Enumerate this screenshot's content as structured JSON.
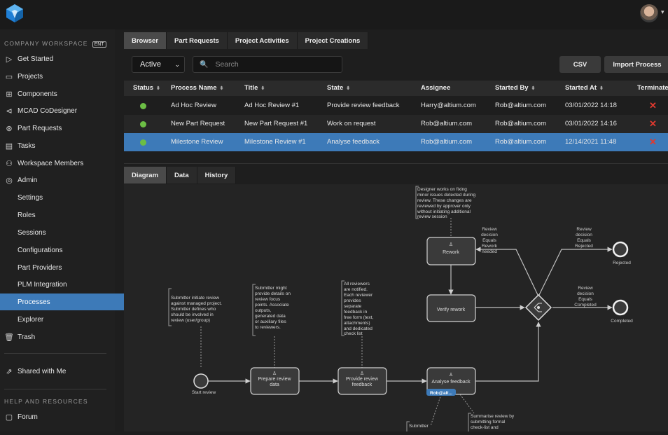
{
  "header": {
    "avatar_caret": "▾"
  },
  "sidebar": {
    "workspace_heading": "COMPANY WORKSPACE",
    "workspace_badge": "ENT",
    "items": [
      {
        "label": "Get Started",
        "icon": "play-icon"
      },
      {
        "label": "Projects",
        "icon": "folder-icon"
      },
      {
        "label": "Components",
        "icon": "chip-icon"
      },
      {
        "label": "MCAD CoDesigner",
        "icon": "codesigner-icon"
      },
      {
        "label": "Part Requests",
        "icon": "part-request-icon"
      },
      {
        "label": "Tasks",
        "icon": "tasks-icon"
      },
      {
        "label": "Workspace Members",
        "icon": "members-icon"
      },
      {
        "label": "Admin",
        "icon": "admin-icon"
      }
    ],
    "admin_items": [
      "Settings",
      "Roles",
      "Sessions",
      "Configurations",
      "Part Providers",
      "PLM Integration",
      "Processes",
      "Explorer"
    ],
    "active_item": "Processes",
    "trash_label": "Trash",
    "shared_label": "Shared with Me",
    "help_heading": "HELP AND RESOURCES",
    "forum_label": "Forum"
  },
  "tabs": [
    "Browser",
    "Part Requests",
    "Project Activities",
    "Project Creations"
  ],
  "active_tab": "Browser",
  "filter": {
    "selected": "Active",
    "search_placeholder": "Search"
  },
  "buttons": {
    "csv": "CSV",
    "import": "Import Process"
  },
  "table": {
    "columns": [
      "Status",
      "Process Name",
      "Title",
      "State",
      "Assignee",
      "Started By",
      "Started At",
      "Terminate"
    ],
    "rows": [
      {
        "name": "Ad Hoc Review",
        "title": "Ad Hoc Review #1",
        "state": "Provide review feedback",
        "assignee": "Harry@altium.com",
        "started_by": "Rob@altium.com",
        "started_at": "03/01/2022 14:18"
      },
      {
        "name": "New Part Request",
        "title": "New Part Request #1",
        "state": "Work on request",
        "assignee": "Rob@altium.com",
        "started_by": "Rob@altium.com",
        "started_at": "03/01/2022 14:16"
      },
      {
        "name": "Milestone Review",
        "title": "Milestone Review #1",
        "state": "Analyse feedback",
        "assignee": "Rob@altium.com",
        "started_by": "Rob@altium.com",
        "started_at": "12/14/2021 11:48"
      }
    ],
    "terminate_symbol": "✕",
    "status_color": "#6cbe45",
    "selected_row": 2
  },
  "bottom_tabs": [
    "Diagram",
    "Data",
    "History"
  ],
  "diagram": {
    "notes": {
      "designer": [
        "Designer works on fixing",
        "minor issues detected during",
        "review. These changes are",
        "reviewed by approver only",
        "without initiating additional",
        "review session"
      ],
      "submitter_initiate": [
        "Submitter initiate review",
        "against managed project.",
        "Submitter defines who",
        "should be involved in",
        "review (user/group)"
      ],
      "submitter_might": [
        "Submitter might",
        "provide details on",
        "review focus",
        "points. Associate",
        "outputs,",
        "generated data",
        "or auxiliary files",
        "to reviewers."
      ],
      "all_reviewers": [
        "All reviewers",
        "are notified.",
        "Each reviewer",
        "provides",
        "separate",
        "feedback in",
        "free form (text,",
        "attachments)",
        "and dedicated",
        "check list"
      ],
      "summarise": [
        "Summarise review by",
        "submitting formal",
        "check-list and"
      ],
      "submitter_bottom": [
        "Submitter"
      ]
    },
    "edges": {
      "rework_needed": [
        "Review",
        "decision",
        "Equals",
        "Rework",
        "needed"
      ],
      "rejected": [
        "Review",
        "decision",
        "Equals",
        "Rejected"
      ],
      "completed": [
        "Review",
        "decision",
        "Equals",
        "Completed"
      ]
    },
    "tasks": {
      "rework": "Rework",
      "verify": "Verify rework",
      "prepare": [
        "Prepare review",
        "data"
      ],
      "provide": [
        "Provide review",
        "feedback"
      ],
      "analyse": "Analyse feedback"
    },
    "events": {
      "start": "Start review",
      "rejected": "Rejected",
      "completed": "Completed"
    },
    "assignee_badge": "Rob@alt..."
  }
}
